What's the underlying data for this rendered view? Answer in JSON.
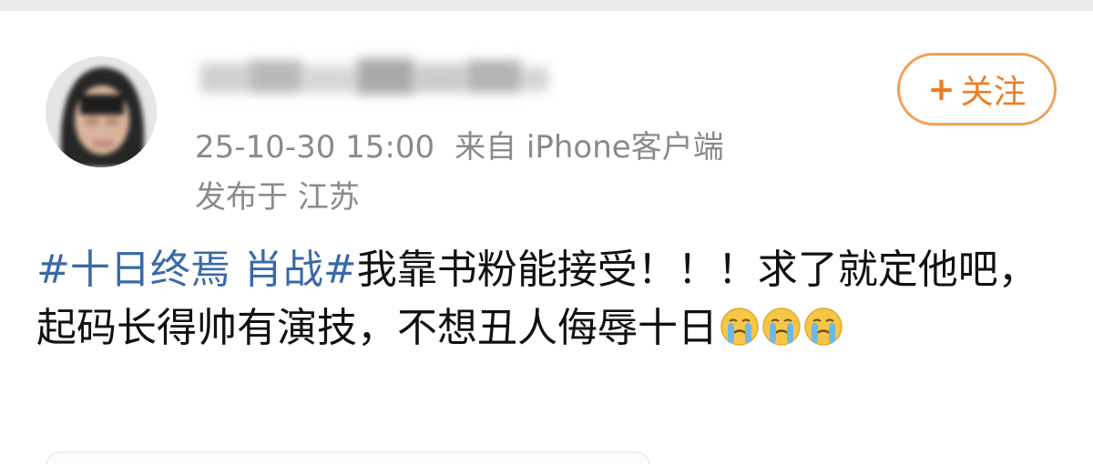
{
  "post": {
    "author": {
      "name_blurred": true
    },
    "timestamp": "25-10-30 15:00",
    "source": "来自 iPhone客户端",
    "location": "发布于 江苏",
    "follow_button": {
      "symbol": "+",
      "label": "关注"
    },
    "content": {
      "topic": "#十日终焉 肖战#",
      "line_a": "我靠书粉能接受！！！求了就定他吧，起码长得帅有演技，不想丑人侮辱十日",
      "emoji_name": "crying-face-icon",
      "emoji_count": 3
    }
  },
  "colors": {
    "topic_link": "#3a6aa6",
    "meta_text": "#8a8a8a",
    "follow_accent": "#ef7e22",
    "follow_border": "#f0a257",
    "emoji_face": "#f7c646",
    "emoji_tears": "#6fb7e8"
  }
}
